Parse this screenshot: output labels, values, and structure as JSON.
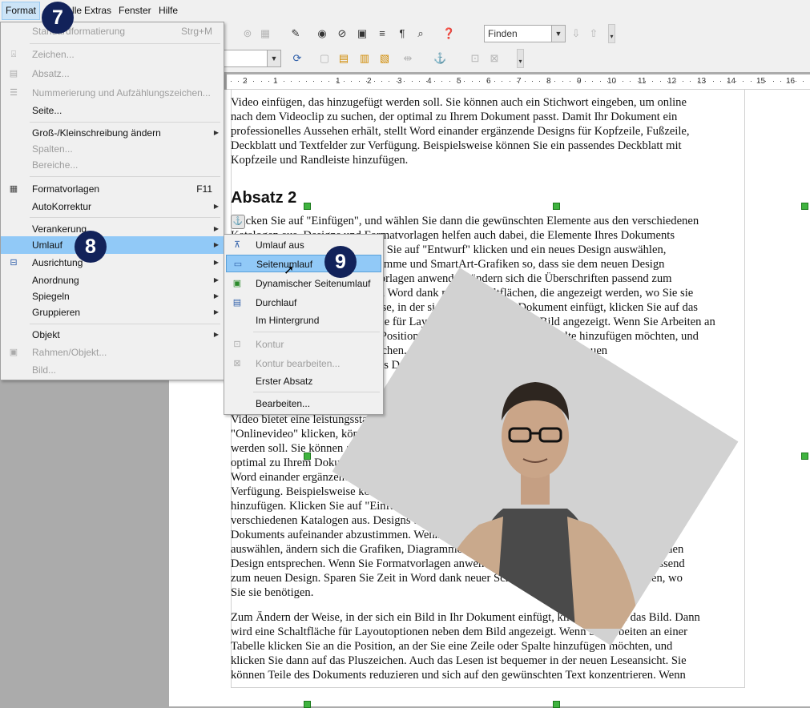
{
  "menubar": {
    "items": [
      {
        "label": "Format"
      },
      {
        "label": "Tabelle"
      },
      {
        "label": "Extras"
      },
      {
        "label": "Fenster"
      },
      {
        "label": "Hilfe"
      }
    ]
  },
  "toolbar": {
    "find_placeholder": "Finden"
  },
  "ruler": {
    "ticks": [
      "2",
      "1",
      "1",
      "2",
      "3",
      "4",
      "5",
      "6",
      "7",
      "8",
      "9",
      "10",
      "11",
      "12",
      "13",
      "14",
      "15",
      "16"
    ]
  },
  "format_menu": {
    "items": [
      {
        "label": "Standardformatierung",
        "shortcut": "Strg+M",
        "disabled": true
      },
      {
        "label": "Zeichen...",
        "disabled": true
      },
      {
        "label": "Absatz...",
        "disabled": true
      },
      {
        "label": "Nummerierung und Aufzählungszeichen...",
        "disabled": true
      },
      {
        "label": "Seite..."
      },
      {
        "label": "Groß-/Kleinschreibung ändern",
        "submenu": true
      },
      {
        "label": "Spalten...",
        "disabled": true
      },
      {
        "label": "Bereiche...",
        "disabled": true
      },
      {
        "label": "Formatvorlagen",
        "shortcut": "F11"
      },
      {
        "label": "AutoKorrektur",
        "submenu": true
      },
      {
        "label": "Verankerung",
        "submenu": true
      },
      {
        "label": "Umlauf",
        "submenu": true,
        "highlighted": true
      },
      {
        "label": "Ausrichtung",
        "submenu": true
      },
      {
        "label": "Anordnung",
        "submenu": true
      },
      {
        "label": "Spiegeln",
        "submenu": true
      },
      {
        "label": "Gruppieren",
        "submenu": true
      },
      {
        "label": "Objekt",
        "submenu": true
      },
      {
        "label": "Rahmen/Objekt...",
        "disabled": true
      },
      {
        "label": "Bild...",
        "disabled": true
      }
    ]
  },
  "wrap_menu": {
    "items": [
      {
        "label": "Umlauf aus"
      },
      {
        "label": "Seitenumlauf",
        "highlighted": true
      },
      {
        "label": "Dynamischer Seitenumlauf"
      },
      {
        "label": "Durchlauf"
      },
      {
        "label": "Im Hintergrund"
      },
      {
        "label": "Kontur",
        "disabled": true
      },
      {
        "label": "Kontur bearbeiten...",
        "disabled": true
      },
      {
        "label": "Erster Absatz"
      },
      {
        "label": "Bearbeiten..."
      }
    ]
  },
  "badges": [
    "7",
    "8",
    "9"
  ],
  "document": {
    "para1": [
      "Video einfügen, das hinzugefügt werden soll. Sie können auch ein Stichwort eingeben, um online",
      "nach dem Videoclip zu suchen, der optimal zu Ihrem Dokument passt. Damit Ihr Dokument ein",
      "professionelles Aussehen erhält, stellt Word einander ergänzende Designs für Kopfzeile, Fußzeile,",
      "Deckblatt und Textfelder zur Verfügung. Beispielsweise können Sie ein passendes Deckblatt mit",
      "Kopfzeile und Randleiste hinzufügen."
    ],
    "heading": "Absatz 2",
    "para2": [
      "Klicken Sie auf \"Einfügen\", und wählen Sie dann die gewünschten Elemente aus den verschiedenen",
      "Katalogen aus. Designs und Formatvorlagen helfen auch dabei, die Elemente Ihres Dokuments",
      "aufeinander abzustimmen. Wenn Sie auf \"Entwurf\" klicken und ein neues Design auswählen,",
      "ändern sich die Grafiken, Diagramme und SmartArt-Grafiken so, dass sie dem neuen Design",
      "entsprechen. Wenn Sie Formatvorlagen anwenden, ändern sich die Überschriften passend zum",
      "neuen Design. Sparen Sie Zeit in Word dank neuer Schaltflächen, die angezeigt werden, wo Sie sie",
      "benötigen. Zum Ändern der Weise, in der sich ein Bild in Ihr Dokument einfügt, klicken Sie auf das",
      "Bild. Dann wird eine Schaltfläche für Layoutoptionen neben dem Bild angezeigt. Wenn Sie Arbeiten an",
      "einer Tabelle klicken Sie an die Position, an der Sie eine Zeile oder Spalte hinzufügen möchten, und",
      "klicken Sie dann auf das Pluszeichen. Auch das Lesen ist bequemer in der neuen",
      "Leseansicht. Sie können Teile des Dokuments reduzieren"
    ],
    "para3": [
      "Video bietet eine leistungsstarke Möglichkeit zur Unterstützung Ihres Standpunkts. Wenn Sie auf",
      "\"Onlinevideo\" klicken, können Sie den Einbettungscode für das Video einfügen, das hinzugefügt",
      "werden soll. Sie können auch ein Stichwort eingeben, um online nach dem Videoclip zu suchen, der",
      "optimal zu Ihrem Dokument passt. Damit Ihr Dokument ein professionelles Aussehen erhält, stellt",
      "Word einander ergänzende Designs für Kopfzeile, Fußzeile, Deckblatt und Textfelder zur",
      "Verfügung. Beispielsweise können Sie ein passendes Deckblatt mit Kopfzeile und Randleiste",
      "hinzufügen. Klicken Sie auf \"Einfügen\", und wählen Sie dann die gewünschten Elemente aus den",
      "verschiedenen Katalogen aus. Designs und Formatvorlagen helfen auch dabei, die Elemente Ihres",
      "Dokuments aufeinander abzustimmen. Wenn Sie auf \"Entwurf\" klicken und ein neues Design",
      "auswählen, ändern sich die Grafiken, Diagramme und SmartArt-Grafiken so, dass sie dem neuen",
      "Design entsprechen. Wenn Sie Formatvorlagen anwenden, ändern sich die Überschriften passend",
      "zum neuen Design. Sparen Sie Zeit in Word dank neuer Schaltflächen, die angezeigt werden, wo",
      "Sie sie benötigen."
    ],
    "para4": [
      "Zum Ändern der Weise, in der sich ein Bild in Ihr Dokument einfügt, klicken Sie auf das Bild. Dann",
      "wird eine Schaltfläche für Layoutoptionen neben dem Bild angezeigt. Wenn Sie Arbeiten an einer",
      "Tabelle klicken Sie an die Position, an der Sie eine Zeile oder Spalte hinzufügen möchten, und",
      "klicken Sie dann auf das Pluszeichen. Auch das Lesen ist bequemer in der neuen Leseansicht. Sie",
      "können Teile des Dokuments reduzieren und sich auf den gewünschten Text konzentrieren. Wenn"
    ]
  }
}
